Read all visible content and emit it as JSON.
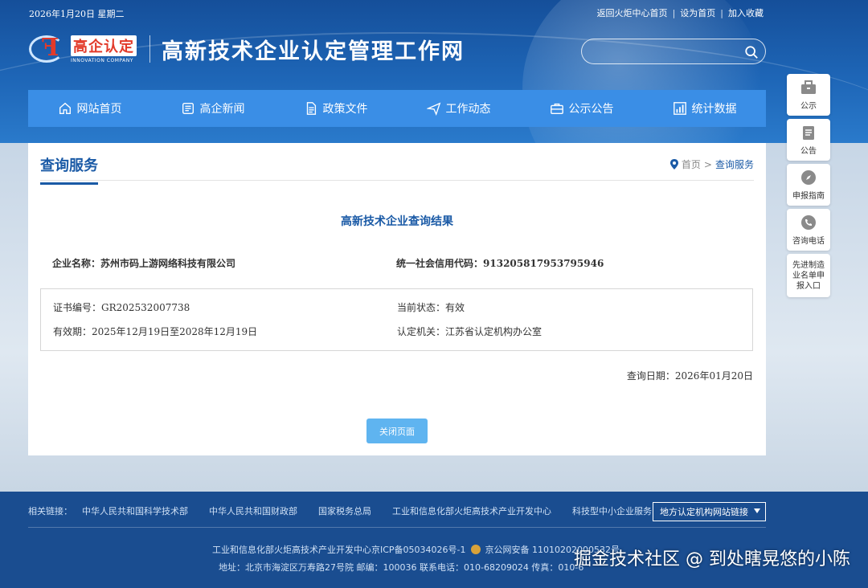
{
  "topbar": {
    "date": "2026年1月20日 星期二",
    "links": [
      "返回火炬中心首页",
      "设为首页",
      "加入收藏"
    ],
    "separator": "|"
  },
  "header": {
    "logo_cn": "高企认定",
    "logo_en": "INNOVATION COMPANY",
    "site_title": "高新技术企业认定管理工作网",
    "search_placeholder": ""
  },
  "nav": {
    "items": [
      {
        "label": "网站首页",
        "icon": "home-icon"
      },
      {
        "label": "高企新闻",
        "icon": "news-icon"
      },
      {
        "label": "政策文件",
        "icon": "document-icon"
      },
      {
        "label": "工作动态",
        "icon": "send-icon"
      },
      {
        "label": "公示公告",
        "icon": "briefcase-icon"
      },
      {
        "label": "统计数据",
        "icon": "chart-icon"
      }
    ]
  },
  "float_bar": {
    "items": [
      {
        "label": "公示",
        "icon": "briefcase-icon"
      },
      {
        "label": "公告",
        "icon": "notice-icon"
      },
      {
        "label": "申报指南",
        "icon": "compass-icon"
      },
      {
        "label": "咨询电话",
        "icon": "phone-icon"
      },
      {
        "label": "先进制造业名单申报入口",
        "icon": ""
      }
    ]
  },
  "main": {
    "page_title": "查询服务",
    "breadcrumb": {
      "home": "首页",
      "sep": ">",
      "current": "查询服务"
    },
    "result_title": "高新技术企业查询结果",
    "company_name_label": "企业名称：",
    "company_name": "苏州市码上游网络科技有限公司",
    "credit_code_label": "统一社会信用代码：",
    "credit_code": "913205817953795946",
    "cert_no_label": "证书编号：",
    "cert_no": "GR202532007738",
    "status_label": "当前状态：",
    "status": "有效",
    "validity_label": "有效期：",
    "validity": "2025年12月19日至2028年12月19日",
    "authority_label": "认定机关：",
    "authority": "江苏省认定机构办公室",
    "query_date_label": "查询日期：",
    "query_date": "2026年01月20日",
    "close_button": "关闭页面"
  },
  "footer": {
    "links_label": "相关链接：",
    "links": [
      "中华人民共和国科学技术部",
      "中华人民共和国财政部",
      "国家税务总局",
      "工业和信息化部火炬高技术产业开发中心",
      "科技型中小企业服务"
    ],
    "local_select": "地方认定机构网站链接",
    "line1_a": "工业和信息化部火炬高技术产业开发中心京ICP备05034026号-1",
    "line1_b": "京公网安备 11010202000532号",
    "line2": "地址：北京市海淀区万寿路27号院 邮编：100036 联系电话：010-68209024 传真：010-6"
  },
  "watermark": "掘金技术社区 @ 到处瞎晃悠的小陈"
}
